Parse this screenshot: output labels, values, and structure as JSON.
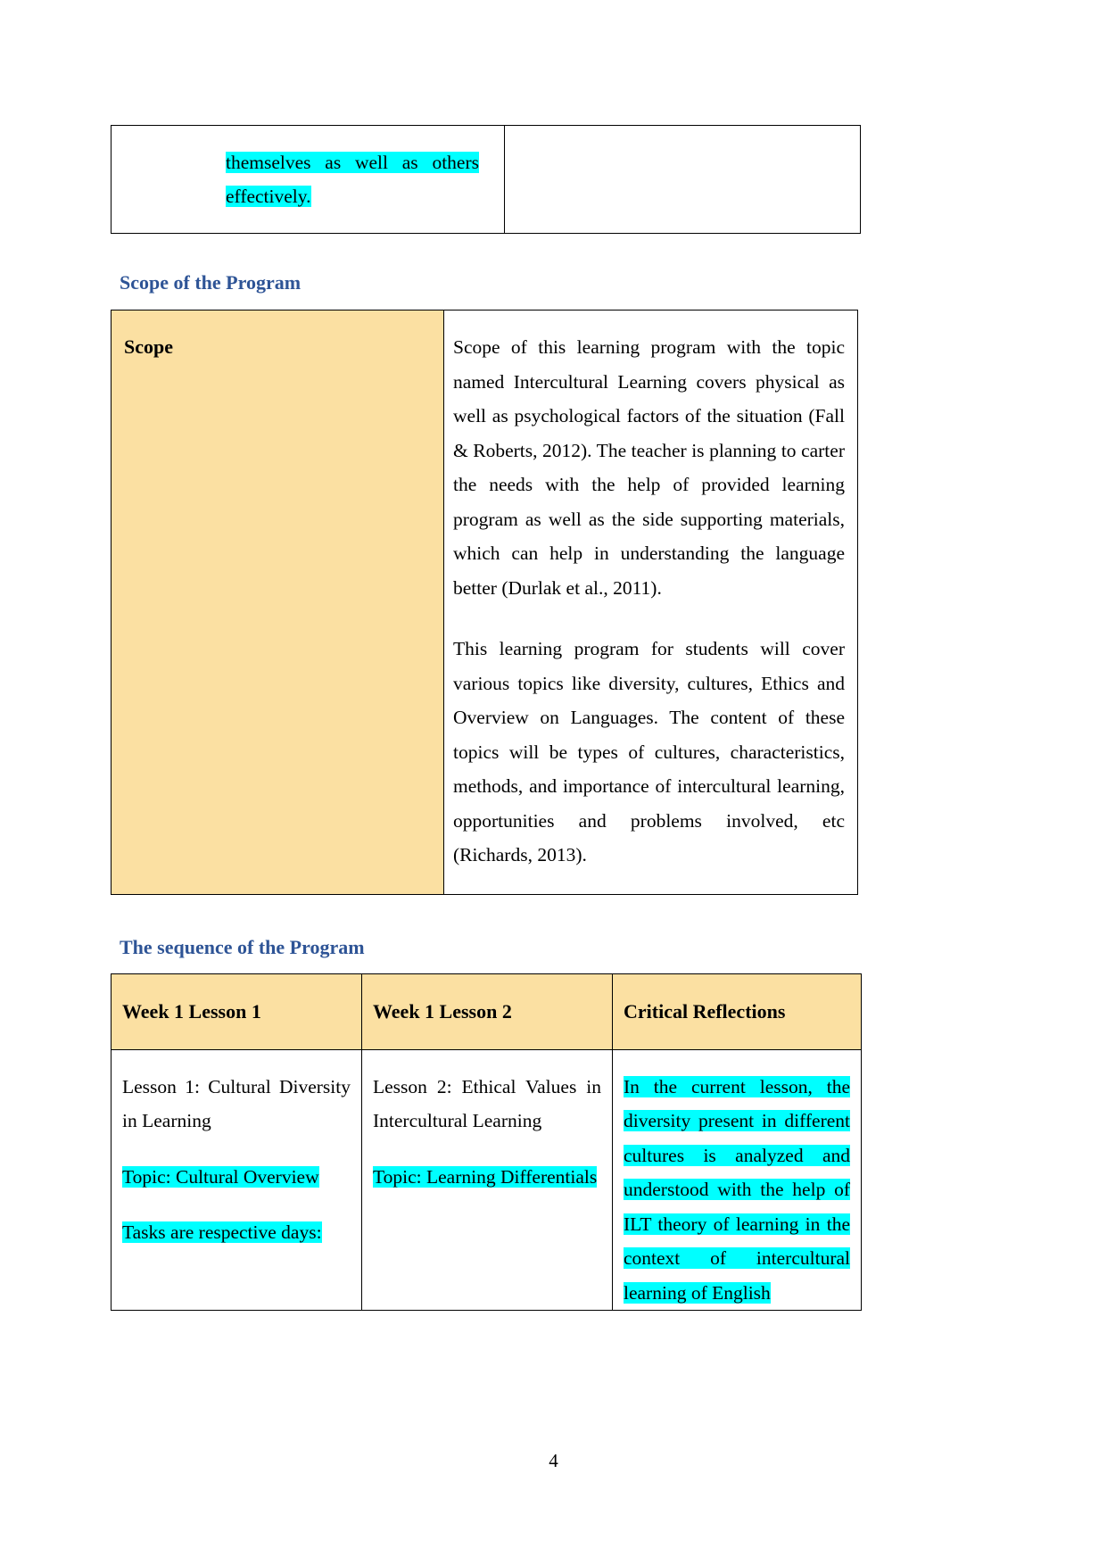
{
  "document": {
    "page_number": "4",
    "colors": {
      "heading_blue": "#2E5496",
      "table_header_tan": "#FBE0A2",
      "highlight_cyan": "#00FFFF",
      "border_black": "#000000",
      "text_black": "#000000"
    }
  },
  "continued_table": {
    "left_cell_text": "themselves as well as others effectively.",
    "right_cell_text": ""
  },
  "scope_section": {
    "heading": "Scope of the Program",
    "label": "Scope",
    "paragraphs": [
      "Scope of this learning program with the topic named Intercultural Learning covers physical as well as psychological factors of the situation (Fall & Roberts, 2012). The teacher is planning to carter the needs with the help of provided learning program as well as the side supporting materials, which can help in understanding the language better (Durlak et al., 2011).",
      "This learning program for students will cover various topics like diversity, cultures, Ethics and Overview on Languages. The content of these topics will be types of cultures, characteristics, methods, and importance of intercultural learning, opportunities and problems involved, etc (Richards, 2013)."
    ]
  },
  "sequence_section": {
    "heading": "The sequence of the Program",
    "headers": [
      "Week 1 Lesson 1",
      "Week 1 Lesson 2",
      "Critical Reflections"
    ],
    "rows": [
      {
        "col1_line1": "Lesson 1: Cultural Diversity in Learning",
        "col1_line2": "Topic: Cultural Overview",
        "col1_line3": "Tasks are respective days:",
        "col2_line1": "Lesson 2: Ethical Values in Intercultural Learning",
        "col2_line2": "Topic: Learning Differentials",
        "col3_line1": "In the current lesson, the diversity present in different cultures is analyzed and understood with the help of ILT theory of learning in the context of intercultural learning of English"
      }
    ]
  }
}
